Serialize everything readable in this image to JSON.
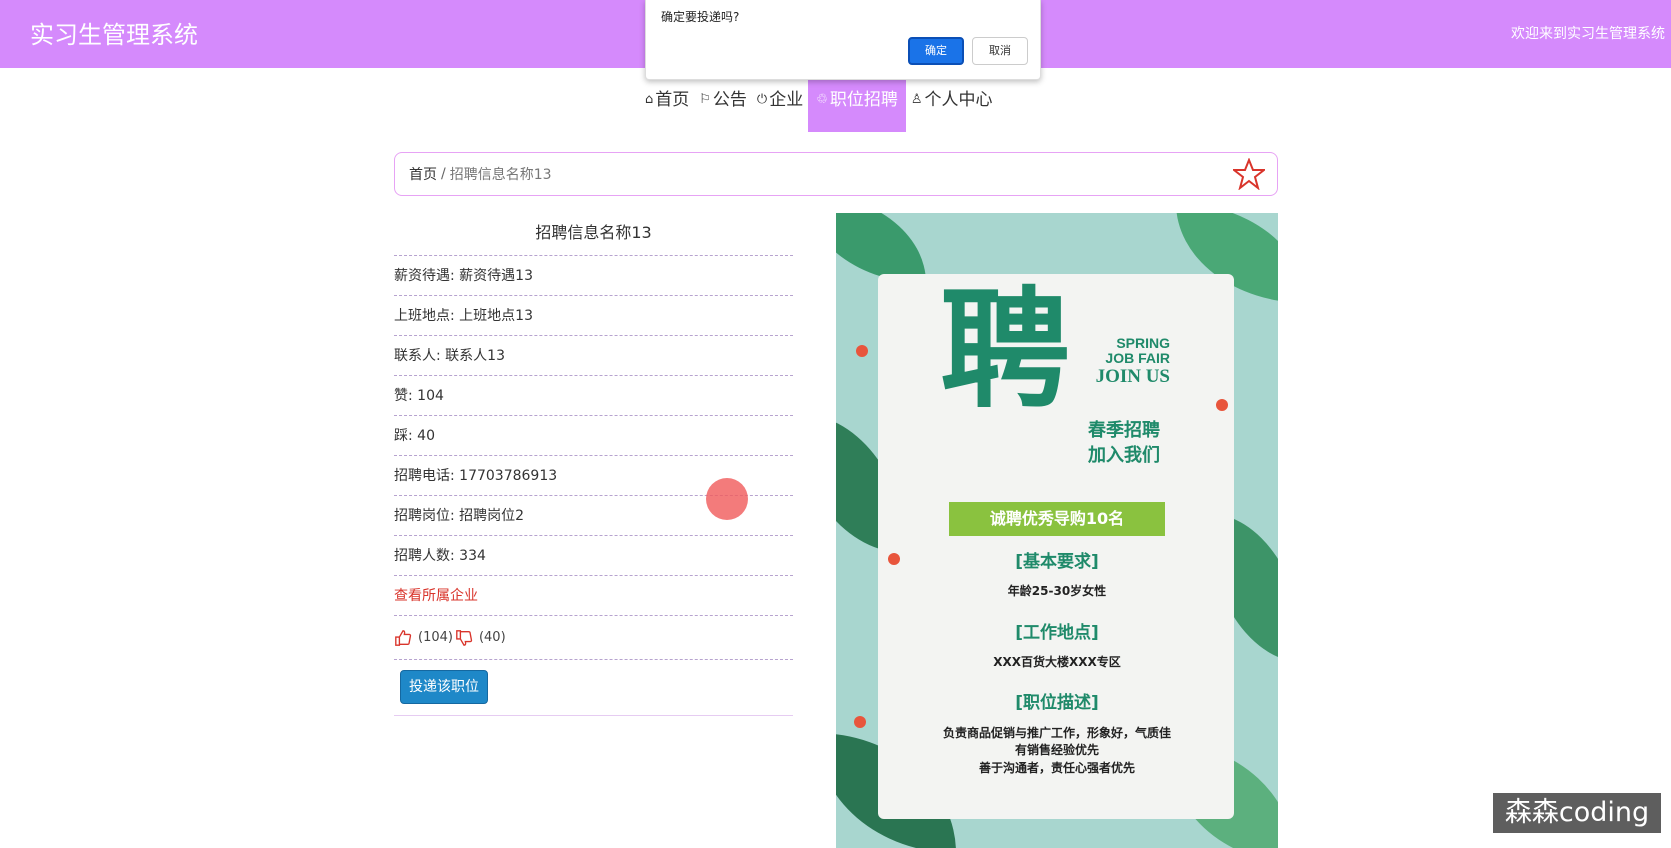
{
  "header": {
    "app_title": "实习生管理系统",
    "welcome": "欢迎来到实习生管理系统"
  },
  "nav": {
    "items": [
      {
        "icon": "home-icon",
        "label": "首页"
      },
      {
        "icon": "flag-icon",
        "label": "公告"
      },
      {
        "icon": "power-icon",
        "label": "企业"
      },
      {
        "icon": "recycle-icon",
        "label": "职位招聘"
      },
      {
        "icon": "user-icon",
        "label": "个人中心"
      }
    ],
    "active_index": 3
  },
  "breadcrumb": {
    "home": "首页",
    "separator": "/",
    "current": "招聘信息名称13"
  },
  "detail": {
    "title": "招聘信息名称13",
    "rows": [
      "薪资待遇: 薪资待遇13",
      "上班地点: 上班地点13",
      "联系人: 联系人13",
      "赞: 104",
      "踩: 40",
      "招聘电话: 17703786913",
      "招聘岗位: 招聘岗位2",
      "招聘人数: 334"
    ],
    "company_link": "查看所属企业",
    "likes": "(104)",
    "dislikes": "(40)",
    "apply_button": "投递该职位"
  },
  "poster": {
    "big_char": "聘",
    "spring": "SPRING",
    "job_fair": "JOB FAIR",
    "join_us": "JOIN US",
    "cn_line1": "春季招聘",
    "cn_line2": "加入我们",
    "ribbon": "诚聘优秀导购10名",
    "head1": "[基本要求]",
    "text1": "年龄25-30岁女性",
    "head2": "[工作地点]",
    "text2": "XXX百货大楼XXX专区",
    "head3": "[职位描述]",
    "text3a": "负责商品促销与推广工作，形象好，气质佳",
    "text3b": "有销售经验优先",
    "text3c": "善于沟通者，责任心强者优先"
  },
  "dialog": {
    "message": "确定要投递吗?",
    "ok": "确定",
    "cancel": "取消"
  },
  "watermark": "森森coding",
  "colors": {
    "accent": "#d58afc",
    "link_red": "#d9342b",
    "button_blue": "#1e88c8",
    "poster_green": "#1f8a6a"
  }
}
